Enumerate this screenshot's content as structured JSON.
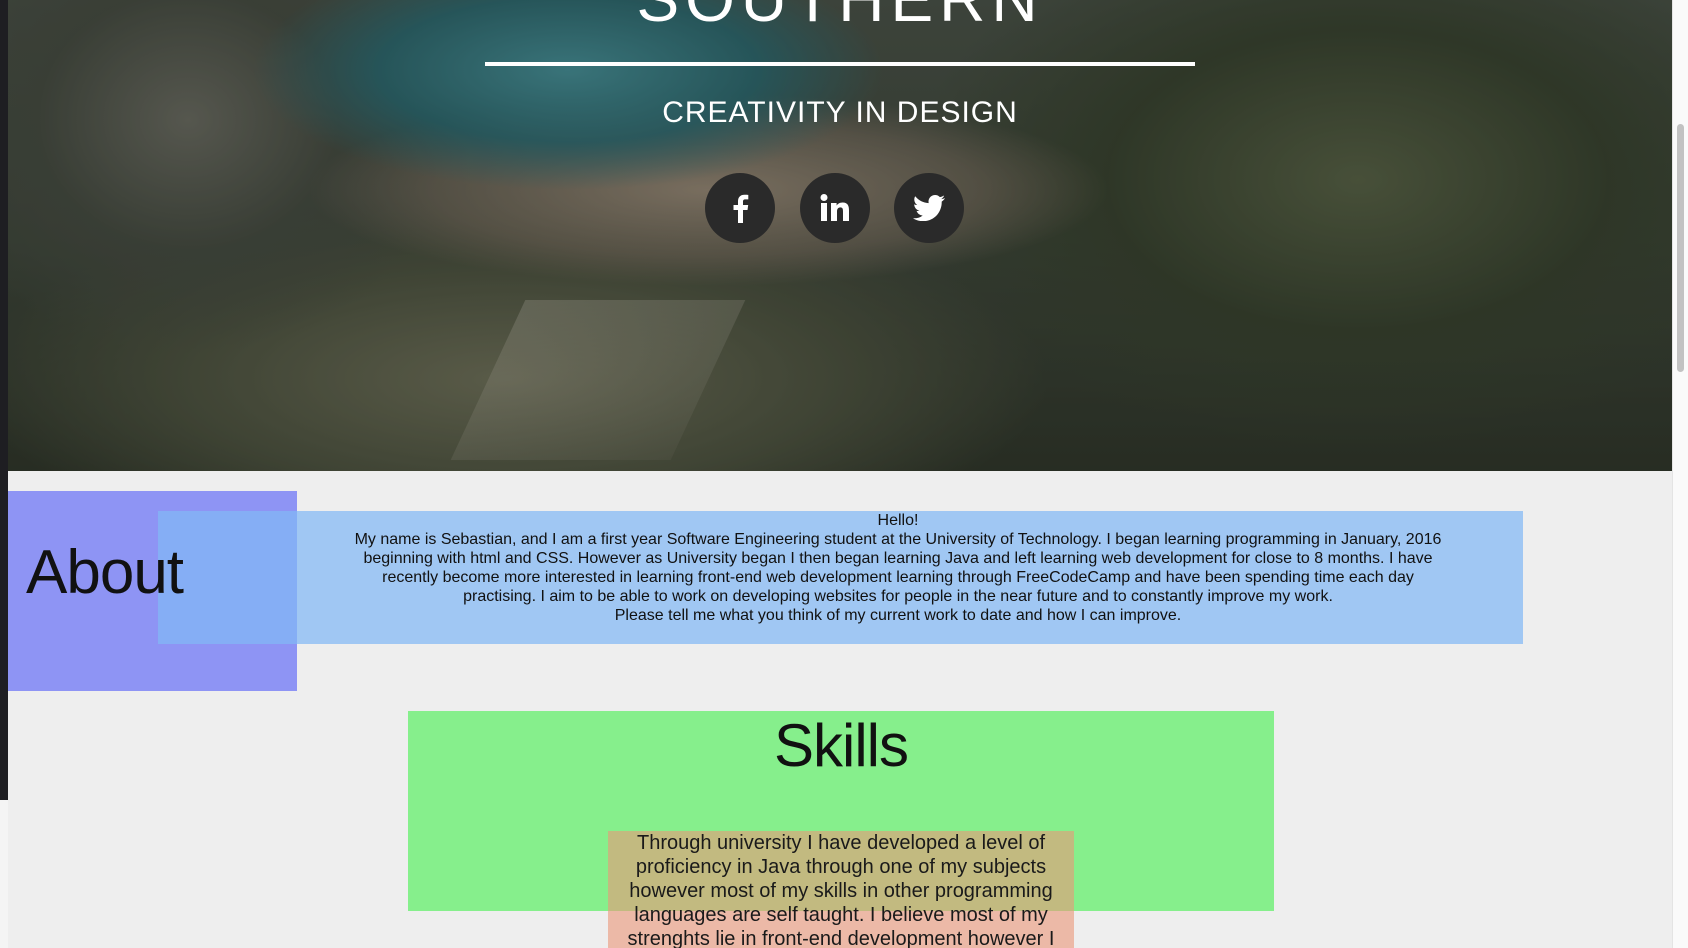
{
  "hero": {
    "title": "SOUTHERN",
    "subtitle": "CREATIVITY IN DESIGN",
    "social": [
      {
        "name": "facebook",
        "icon": "facebook-icon"
      },
      {
        "name": "linkedin",
        "icon": "linkedin-icon"
      },
      {
        "name": "twitter",
        "icon": "twitter-icon"
      }
    ]
  },
  "about": {
    "title": "About",
    "greeting": "Hello!",
    "body": "My name is Sebastian, and I am a first year Software Engineering student at the University of Technology. I began learning programming in January, 2016 beginning with html and CSS. However as University began I then began learning Java and left learning web development for close to 8 months. I have recently become more interested in learning front-end web development learning through FreeCodeCamp and have been spending time each day practising. I aim to be able to work on developing websites for people in the near future and to constantly improve my work.",
    "closing": "Please tell me what you think of my current work to date and how I can improve.",
    "box_color": "#8e94f4",
    "text_box_color": "#82b9f5"
  },
  "skills": {
    "title": "Skills",
    "body": "Through university I have developed a level of proficiency in Java through one of my subjects however most of my skills in other programming languages are self taught. I believe most of my strenghts lie in front-end development however I",
    "box_color": "#86ef8c",
    "text_box_color": "#eb9678"
  }
}
